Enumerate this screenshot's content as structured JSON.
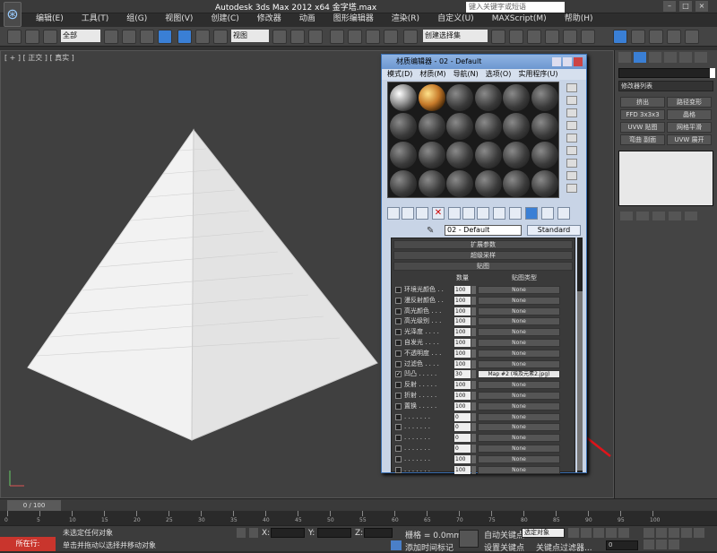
{
  "app": {
    "title": "Autodesk 3ds Max  2012 x64      金字塔.max",
    "search_placeholder": "键入关键字或短语",
    "menu": [
      "编辑(E)",
      "工具(T)",
      "组(G)",
      "视图(V)",
      "创建(C)",
      "修改器",
      "动画",
      "图形编辑器",
      "渲染(R)",
      "自定义(U)",
      "MAXScript(M)",
      "帮助(H)"
    ]
  },
  "toolbar": {
    "selection_filter": "全部",
    "ref_coord": "视图",
    "named_selection": "创建选择集"
  },
  "viewport": {
    "label": "[ + ] [ 正交 ] [ 真实 ]"
  },
  "command_panel": {
    "modifier_list": "修改器列表",
    "buttons": [
      "挤出",
      "路径变形",
      "FFD 3x3x3",
      "晶格",
      "UVW 贴图",
      "网格平滑",
      "弯曲 副面",
      "UVW 展开"
    ]
  },
  "material_editor": {
    "title": "材质编辑器 - 02 - Default",
    "menu": [
      "模式(D)",
      "材质(M)",
      "导航(N)",
      "选项(O)",
      "实用程序(U)"
    ],
    "material_name": "02 - Default",
    "material_type": "Standard",
    "rollouts": [
      "扩展参数",
      "超级采样",
      "贴图"
    ],
    "map_headers": {
      "amount": "数量",
      "map_type": "贴图类型"
    },
    "maps": [
      {
        "label": "环境光颜色 . .",
        "amount": "100",
        "map": "None",
        "checked": false
      },
      {
        "label": "漫反射颜色 . .",
        "amount": "100",
        "map": "None",
        "checked": false
      },
      {
        "label": "高光颜色 . . .",
        "amount": "100",
        "map": "None",
        "checked": false
      },
      {
        "label": "高光级别 . . .",
        "amount": "100",
        "map": "None",
        "checked": false
      },
      {
        "label": "光泽度 . . . .",
        "amount": "100",
        "map": "None",
        "checked": false
      },
      {
        "label": "自发光 . . . .",
        "amount": "100",
        "map": "None",
        "checked": false
      },
      {
        "label": "不透明度 . . .",
        "amount": "100",
        "map": "None",
        "checked": false
      },
      {
        "label": "过滤色 . . . .",
        "amount": "100",
        "map": "None",
        "checked": false
      },
      {
        "label": "凹凸 . . . . .",
        "amount": "30",
        "map": "Map #2 (埃及元素2.jpg)",
        "checked": true
      },
      {
        "label": "反射 . . . . .",
        "amount": "100",
        "map": "None",
        "checked": false
      },
      {
        "label": "折射 . . . . .",
        "amount": "100",
        "map": "None",
        "checked": false
      },
      {
        "label": "置换 . . . . .",
        "amount": "100",
        "map": "None",
        "checked": false
      },
      {
        "label": ". . . . . . .",
        "amount": "0",
        "map": "None",
        "checked": false
      },
      {
        "label": ". . . . . . .",
        "amount": "0",
        "map": "None",
        "checked": false
      },
      {
        "label": ". . . . . . .",
        "amount": "0",
        "map": "None",
        "checked": false
      },
      {
        "label": ". . . . . . .",
        "amount": "0",
        "map": "None",
        "checked": false
      },
      {
        "label": ". . . . . . .",
        "amount": "100",
        "map": "None",
        "checked": false
      },
      {
        "label": ". . . . . . .",
        "amount": "100",
        "map": "None",
        "checked": false
      }
    ]
  },
  "timeline": {
    "frame": "0 / 100",
    "ticks": [
      "0",
      "5",
      "10",
      "15",
      "20",
      "25",
      "30",
      "35",
      "40",
      "45",
      "50",
      "55",
      "60",
      "65",
      "70",
      "75",
      "80",
      "85",
      "90",
      "95",
      "100"
    ]
  },
  "status": {
    "badge": "所在行:",
    "line1": "未选定任何对象",
    "line2": "单击并拖动以选择并移动对象",
    "x_label": "X:",
    "y_label": "Y:",
    "z_label": "Z:",
    "grid": "栅格 = 0.0mm",
    "auto_key": "自动关键点",
    "selected": "选定对象",
    "set_key": "设置关键点",
    "key_filters": "关键点过滤器...",
    "add_time_tag": "添加时间标记",
    "frame_value": "0"
  },
  "colors": {
    "annotation_red": "#e0141a",
    "status_badge": "#c9352d"
  }
}
